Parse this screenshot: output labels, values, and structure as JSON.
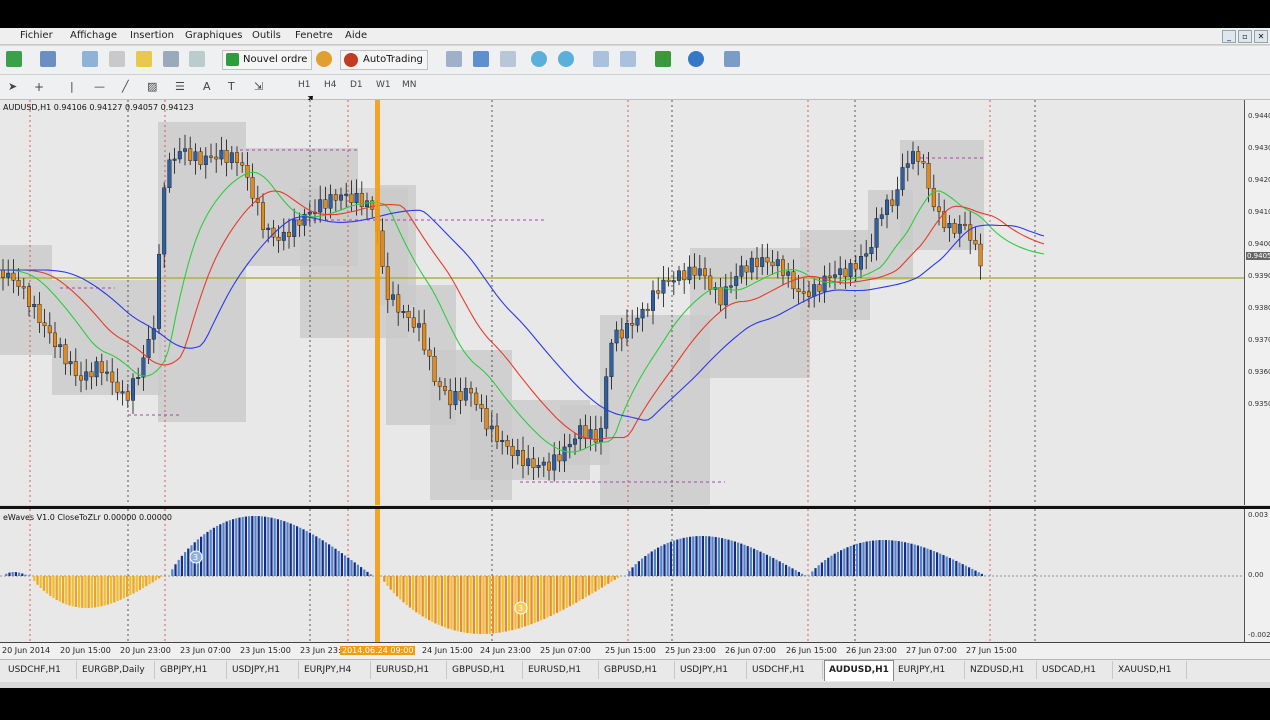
{
  "menu": [
    "Fichier",
    "Affichage",
    "Insertion",
    "Graphiques",
    "Outils",
    "Fenetre",
    "Aide"
  ],
  "toolbar": {
    "new_order": "Nouvel ordre",
    "autotrading": "AutoTrading"
  },
  "timeframes": [
    "H1",
    "H4",
    "D1",
    "W1",
    "MN"
  ],
  "chart": {
    "symbol_info": "AUDUSD,H1  0.94106 0.94127 0.94057 0.94123",
    "price_labels": [
      "0.9440",
      "0.9430",
      "0.9420",
      "0.9410",
      "0.9400",
      "0.9390",
      "0.9380",
      "0.9370",
      "0.9360",
      "0.9350"
    ],
    "current_price_label": "0.9405",
    "time_labels": [
      "20 Jun 2014",
      "20 Jun 15:00",
      "20 Jun 23:00",
      "23 Jun 07:00",
      "23 Jun 15:00",
      "23 Jun 23:00",
      "24 Jun 15:00",
      "24 Jun 23:00",
      "25 Jun 07:00",
      "25 Jun 15:00",
      "25 Jun 23:00",
      "26 Jun 07:00",
      "26 Jun 15:00",
      "26 Jun 23:00",
      "27 Jun 07:00",
      "27 Jun 15:00"
    ],
    "crosshair_time_label": "2014.06.24 09:00"
  },
  "indicator": {
    "info": "eWaves V1.0 CloseToZLr 0.00000 0.00000",
    "scale_labels": [
      "0.003",
      "0.00",
      "-0.002"
    ],
    "wave_labels": [
      "3",
      "3"
    ]
  },
  "tabs": [
    "USDCHF,H1",
    "EURGBP,Daily",
    "GBPJPY,H1",
    "USDJPY,H1",
    "EURJPY,H4",
    "EURUSD,H1",
    "GBPUSD,H1",
    "EURUSD,H1",
    "GBPUSD,H1",
    "USDJPY,H1",
    "USDCHF,H1",
    "AUDUSD,H1",
    "EURJPY,H1",
    "NZDUSD,H1",
    "USDCAD,H1",
    "XAUUSD,H1"
  ],
  "active_tab": "AUDUSD,H1",
  "colors": {
    "bull": "#2f5f9e",
    "bear": "#e08a1e",
    "ma_fast": "#2ecc40",
    "ma_mid": "#e83a2a",
    "ma_slow": "#2a3ae8",
    "cursor": "#f39c12"
  }
}
